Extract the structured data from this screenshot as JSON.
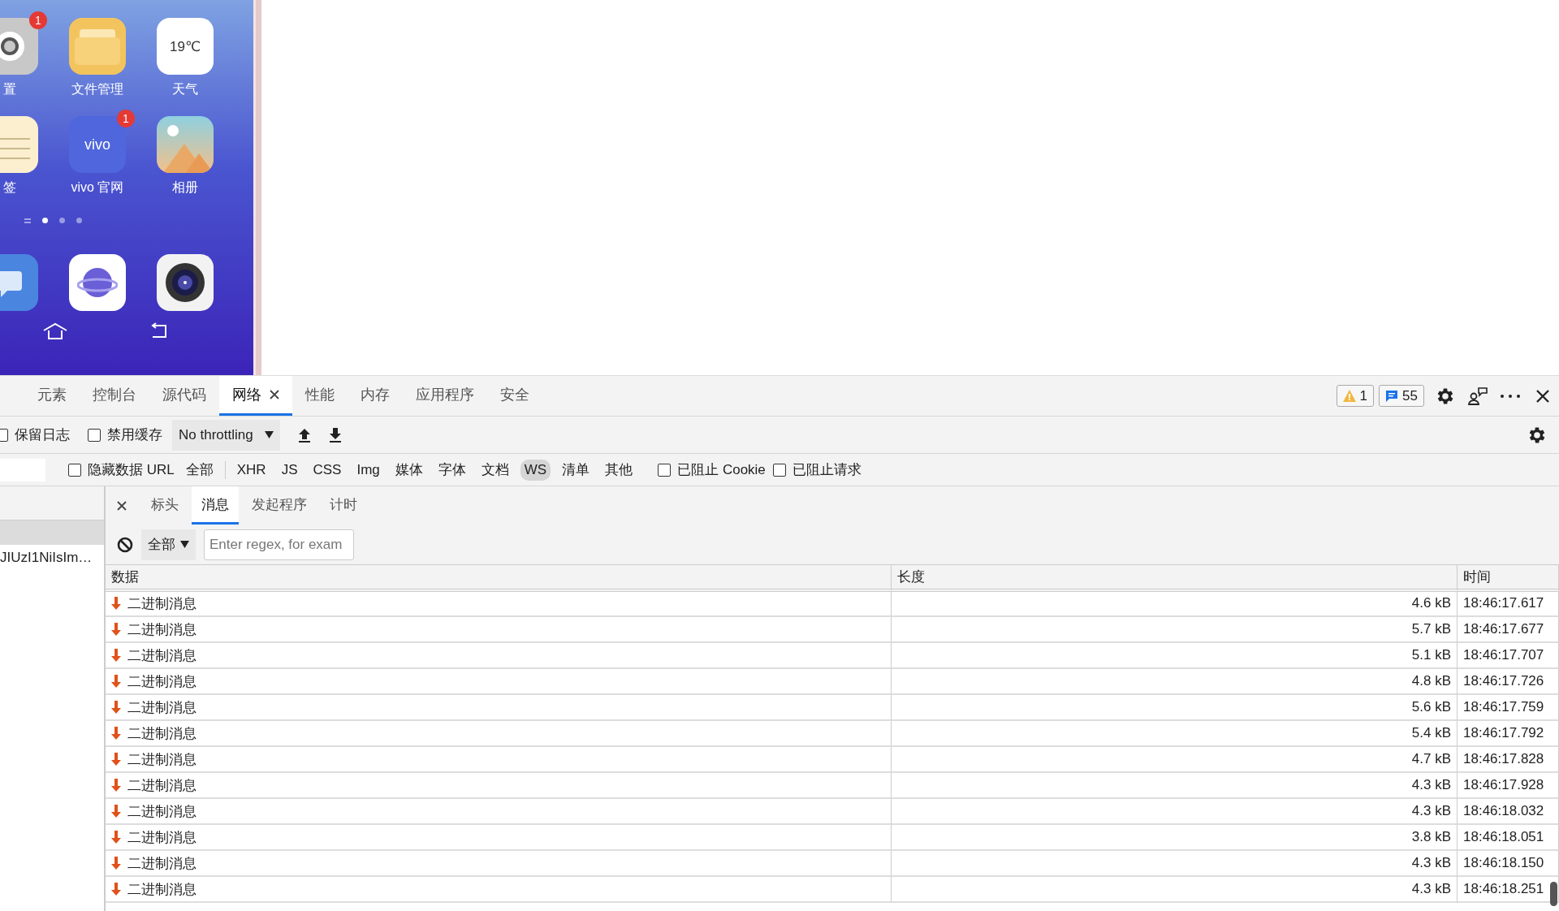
{
  "phone": {
    "apps": [
      {
        "label": "置",
        "kind": "settings",
        "badge": "1"
      },
      {
        "label": "文件管理",
        "kind": "folder"
      },
      {
        "label": "天气",
        "kind": "weather",
        "text": "19℃"
      },
      {
        "label": "签",
        "kind": "note"
      },
      {
        "label": "vivo 官网",
        "kind": "brand",
        "text": "vivo",
        "badge": "1"
      },
      {
        "label": "相册",
        "kind": "gallery"
      }
    ],
    "page_dots": [
      {
        "selected": true
      },
      {
        "selected": false
      },
      {
        "selected": false
      }
    ],
    "dock": [
      {
        "kind": "chat"
      },
      {
        "kind": "browser"
      },
      {
        "kind": "camera"
      }
    ]
  },
  "devtools": {
    "tabs": [
      {
        "label": "元素",
        "selected": false
      },
      {
        "label": "控制台",
        "selected": false
      },
      {
        "label": "源代码",
        "selected": false
      },
      {
        "label": "网络",
        "selected": true,
        "closable": true
      },
      {
        "label": "性能",
        "selected": false
      },
      {
        "label": "内存",
        "selected": false
      },
      {
        "label": "应用程序",
        "selected": false
      },
      {
        "label": "安全",
        "selected": false
      }
    ],
    "warnings": "1",
    "messages": "55",
    "toolbar": {
      "checks": [
        {
          "label": "保留日志",
          "checked": false
        },
        {
          "label": "禁用缓存",
          "checked": false
        }
      ],
      "throttling": "No throttling"
    },
    "filter": {
      "hide_data": {
        "label": "隐藏数据 URL",
        "checked": false
      },
      "types": [
        {
          "label": "全部",
          "selected": false
        },
        {
          "label": "XHR",
          "selected": false
        },
        {
          "label": "JS",
          "selected": false
        },
        {
          "label": "CSS",
          "selected": false
        },
        {
          "label": "Img",
          "selected": false
        },
        {
          "label": "媒体",
          "selected": false
        },
        {
          "label": "字体",
          "selected": false
        },
        {
          "label": "文档",
          "selected": false
        },
        {
          "label": "WS",
          "selected": true
        },
        {
          "label": "清单",
          "selected": false
        },
        {
          "label": "其他",
          "selected": false
        }
      ],
      "blocked": [
        {
          "label": "已阻止 Cookie",
          "checked": false
        },
        {
          "label": "已阻止请求",
          "checked": false
        }
      ]
    },
    "requests": [
      {
        "name": "JIUzI1NiIsIm…"
      }
    ],
    "detail_tabs": [
      {
        "label": "标头",
        "selected": false
      },
      {
        "label": "消息",
        "selected": true
      },
      {
        "label": "发起程序",
        "selected": false
      },
      {
        "label": "计时",
        "selected": false
      }
    ],
    "message_filter": {
      "type": "全部",
      "placeholder": "Enter regex, for exam"
    },
    "columns": [
      "数据",
      "长度",
      "时间"
    ],
    "rows": [
      {
        "kind": "received",
        "data": "二进制消息",
        "length": "4.6 kB",
        "time": "18:46:17.617"
      },
      {
        "kind": "received",
        "data": "二进制消息",
        "length": "5.7 kB",
        "time": "18:46:17.677"
      },
      {
        "kind": "received",
        "data": "二进制消息",
        "length": "5.1 kB",
        "time": "18:46:17.707"
      },
      {
        "kind": "received",
        "data": "二进制消息",
        "length": "4.8 kB",
        "time": "18:46:17.726"
      },
      {
        "kind": "received",
        "data": "二进制消息",
        "length": "5.6 kB",
        "time": "18:46:17.759"
      },
      {
        "kind": "received",
        "data": "二进制消息",
        "length": "5.4 kB",
        "time": "18:46:17.792"
      },
      {
        "kind": "received",
        "data": "二进制消息",
        "length": "4.7 kB",
        "time": "18:46:17.828"
      },
      {
        "kind": "received",
        "data": "二进制消息",
        "length": "4.3 kB",
        "time": "18:46:17.928"
      },
      {
        "kind": "received",
        "data": "二进制消息",
        "length": "4.3 kB",
        "time": "18:46:18.032"
      },
      {
        "kind": "received",
        "data": "二进制消息",
        "length": "3.8 kB",
        "time": "18:46:18.051"
      },
      {
        "kind": "received",
        "data": "二进制消息",
        "length": "4.3 kB",
        "time": "18:46:18.150"
      },
      {
        "kind": "received",
        "data": "二进制消息",
        "length": "4.3 kB",
        "time": "18:46:18.251"
      }
    ]
  }
}
